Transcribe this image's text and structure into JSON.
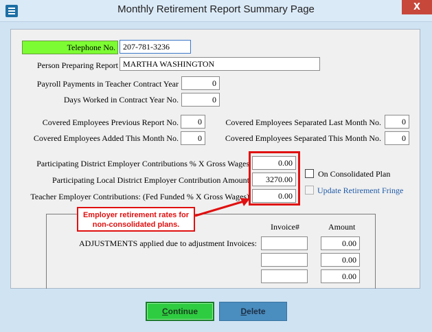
{
  "window": {
    "title": "Monthly Retirement Report Summary Page",
    "close_glyph": "X"
  },
  "form": {
    "telephone": {
      "label": "Telephone No.",
      "value": "207-781-3236"
    },
    "preparer": {
      "label": "Person Preparing Report",
      "value": "MARTHA WASHINGTON"
    },
    "payroll_payments": {
      "label": "Payroll Payments in Teacher Contract Year",
      "value": "0"
    },
    "days_worked": {
      "label": "Days Worked in Contract Year No.",
      "value": "0"
    },
    "covered_prev": {
      "label": "Covered Employees Previous Report No.",
      "value": "0"
    },
    "covered_added": {
      "label": "Covered Employees Added This Month No.",
      "value": "0"
    },
    "separated_last": {
      "label": "Covered Employees Separated Last Month No.",
      "value": "0"
    },
    "separated_this": {
      "label": "Covered Employees Separated This Month No.",
      "value": "0"
    },
    "district_contrib": {
      "label": "Participating District Employer Contributions % X Gross Wages",
      "value": "0.00"
    },
    "local_district_contrib": {
      "label": "Participating Local District Employer Contribution Amount",
      "value": "3270.00"
    },
    "teacher_contrib": {
      "label": "Teacher Employer Contributions: (Fed Funded % X Gross Wages)",
      "value": "0.00"
    },
    "consolidated": {
      "label": "On Consolidated Plan",
      "checked": false
    },
    "update_fringe": {
      "label": "Update Retirement Fringe",
      "checked": false,
      "enabled": false
    }
  },
  "adjustments": {
    "label": "ADJUSTMENTS applied due to adjustment Invoices:",
    "invoice_header": "Invoice#",
    "amount_header": "Amount",
    "rows": [
      {
        "invoice": "",
        "amount": "0.00"
      },
      {
        "invoice": "",
        "amount": "0.00"
      },
      {
        "invoice": "",
        "amount": "0.00"
      }
    ]
  },
  "annotation": {
    "callout_text": "Employer retirement rates for non-consolidated plans.",
    "highlight_color": "#e01010"
  },
  "buttons": {
    "continue_label": "Continue",
    "delete_label": "Delete"
  },
  "colors": {
    "telephone_label_bg": "#7cfc32",
    "continue_bg": "#2ecc40",
    "delete_bg": "#4a8dbf",
    "close_bg": "#c7473b"
  }
}
